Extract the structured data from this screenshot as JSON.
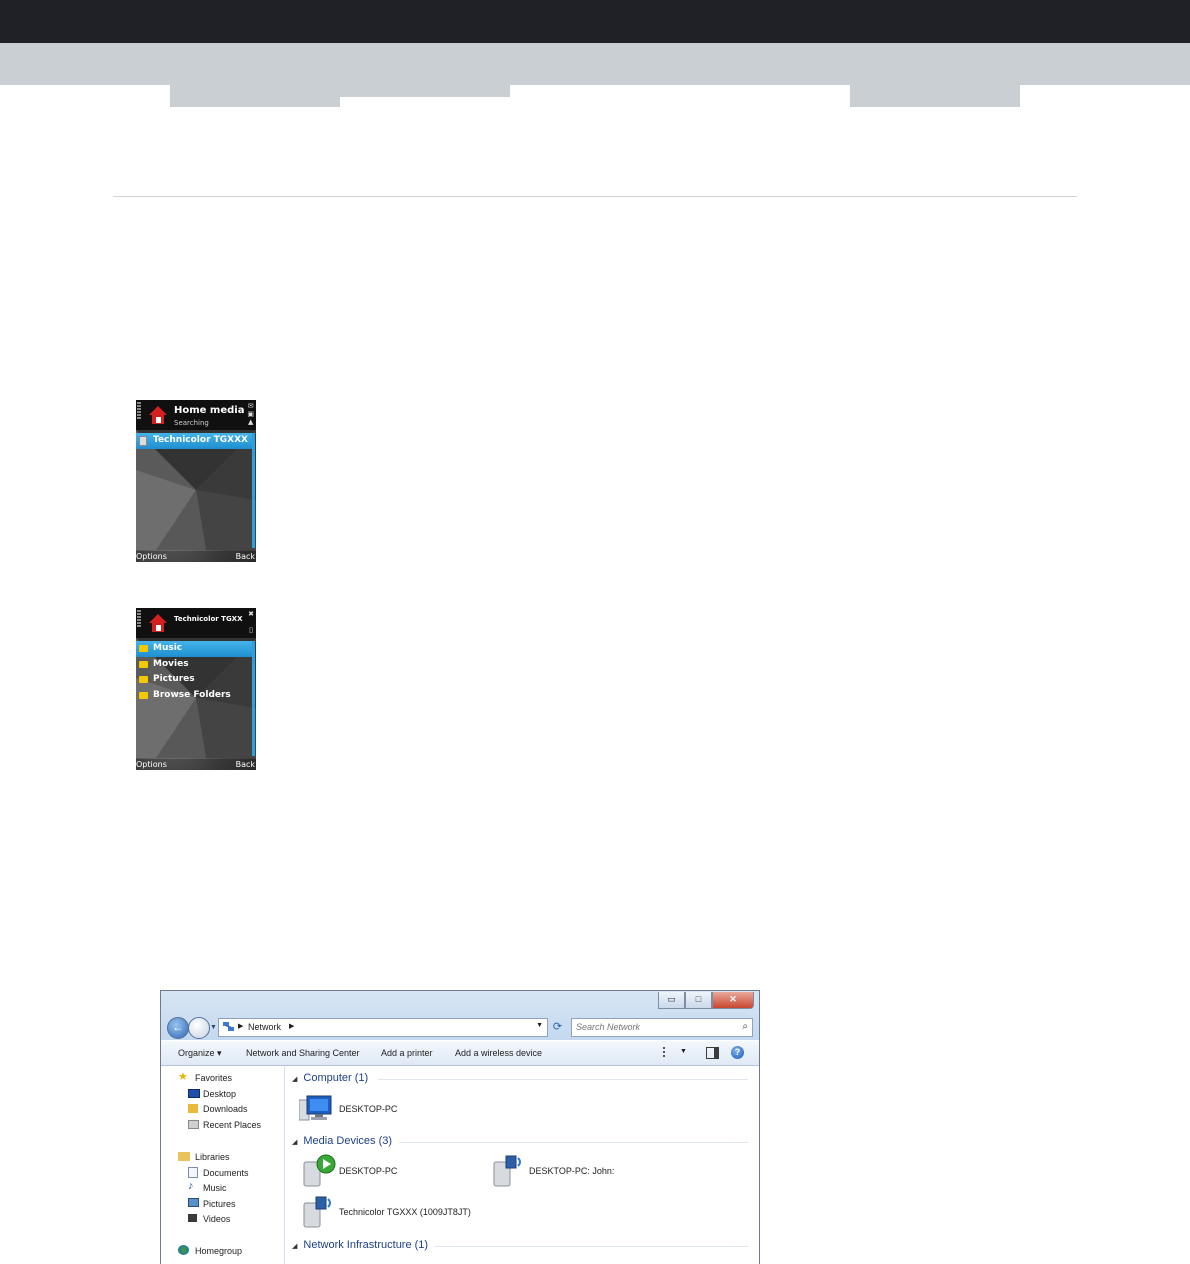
{
  "phone1": {
    "title": "Home media",
    "subtitle": "Searching",
    "items": [
      "Technicolor TGXXX"
    ],
    "left_softkey": "Options",
    "right_softkey": "Back"
  },
  "phone2": {
    "title": "Technicolor TGXX",
    "items": [
      "Music",
      "Movies",
      "Pictures",
      "Browse Folders"
    ],
    "left_softkey": "Options",
    "right_softkey": "Back"
  },
  "explorer": {
    "caption_buttons": {
      "minimize": "▭",
      "maximize": "□",
      "close": "✕"
    },
    "address": {
      "crumb": "Network"
    },
    "search": {
      "placeholder": "Search Network"
    },
    "commands": {
      "organize": "Organize ▾",
      "network_sharing": "Network and Sharing Center",
      "add_printer": "Add a printer",
      "add_wireless": "Add a wireless device"
    },
    "sidebar": {
      "favorites": "Favorites",
      "desktop": "Desktop",
      "downloads": "Downloads",
      "recent": "Recent Places",
      "libraries": "Libraries",
      "documents": "Documents",
      "music": "Music",
      "pictures": "Pictures",
      "videos": "Videos",
      "homegroup": "Homegroup"
    },
    "groups": {
      "computer": "Computer (1)",
      "media": "Media Devices (3)",
      "network": "Network Infrastructure (1)"
    },
    "items": {
      "computer_pc": "DESKTOP-PC",
      "media_pc": "DESKTOP-PC",
      "media_pc_john": "DESKTOP-PC: John:",
      "media_technicolor": "Technicolor TGXXX (1009JT8JT)"
    },
    "colors": {
      "group_heading": "#1e3f8a",
      "frame": "#c2d7ee"
    }
  }
}
